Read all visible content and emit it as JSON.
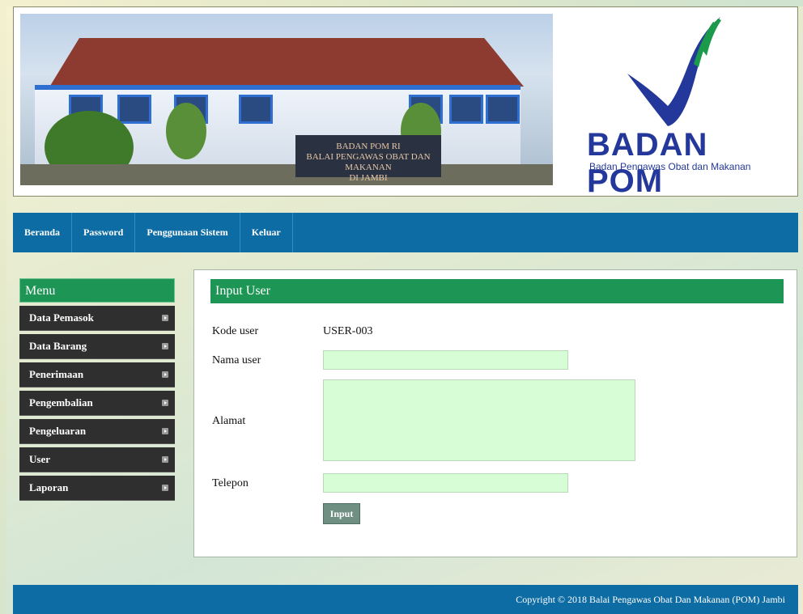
{
  "banner": {
    "photo_sign": "BADAN POM RI\nBALAI PENGAWAS OBAT DAN MAKANAN\nDI JAMBI",
    "brand_name": "BADAN POM",
    "brand_tagline": "Badan Pengawas Obat dan Makanan",
    "brand_color": "#23389a",
    "accent_green": "#1a9a4a"
  },
  "nav": {
    "items": [
      "Beranda",
      "Password",
      "Penggunaan Sistem",
      "Keluar"
    ]
  },
  "sidebar": {
    "title": "Menu",
    "items": [
      "Data Pemasok",
      "Data Barang",
      "Penerimaan",
      "Pengembalian",
      "Pengeluaran",
      "User",
      "Laporan"
    ]
  },
  "form": {
    "title": "Input User",
    "kode_label": "Kode user",
    "kode_value": "USER-003",
    "nama_label": "Nama user",
    "nama_value": "",
    "alamat_label": "Alamat",
    "alamat_value": "",
    "telepon_label": "Telepon",
    "telepon_value": "",
    "submit_label": "Input"
  },
  "footer": {
    "copyright": "Copyright © 2018 Balai Pengawas Obat Dan Makanan (POM) Jambi"
  },
  "colors": {
    "nav_bg": "#0d6ca3",
    "green_header": "#1d9555",
    "menu_item_bg": "#2f2f2f",
    "input_bg": "#d6fdd6"
  }
}
